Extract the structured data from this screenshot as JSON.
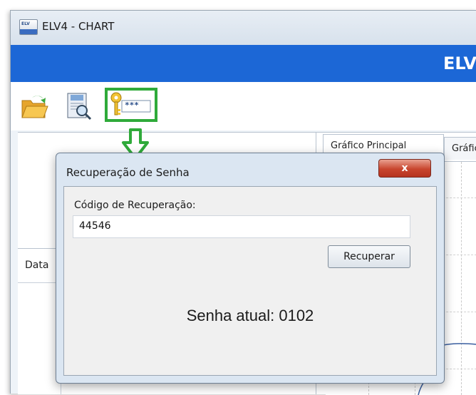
{
  "window": {
    "title": "ELV4 - CHART",
    "app_icon_label": "ELV"
  },
  "banner": {
    "title": "ELV"
  },
  "toolbar": {
    "items": [
      {
        "name": "open-folder",
        "icon": "folder-open-icon"
      },
      {
        "name": "report",
        "icon": "report-search-icon"
      },
      {
        "name": "password",
        "icon": "key-password-icon",
        "text": "***"
      }
    ],
    "highlight_color": "#2faa3a"
  },
  "left_panel": {
    "data_header": "Data"
  },
  "tabs": [
    {
      "label": "Gráfico Principal"
    },
    {
      "label": "Gráfic"
    }
  ],
  "dialog": {
    "title": "Recuperação de Senha",
    "close_label": "x",
    "field_label": "Código de Recuperação:",
    "code_value": "44546",
    "recover_button": "Recuperar",
    "password_text": "Senha atual: 0102"
  },
  "colors": {
    "banner": "#1c67d6",
    "close_button": "#c8452e",
    "arrow": "#2faa3a"
  }
}
